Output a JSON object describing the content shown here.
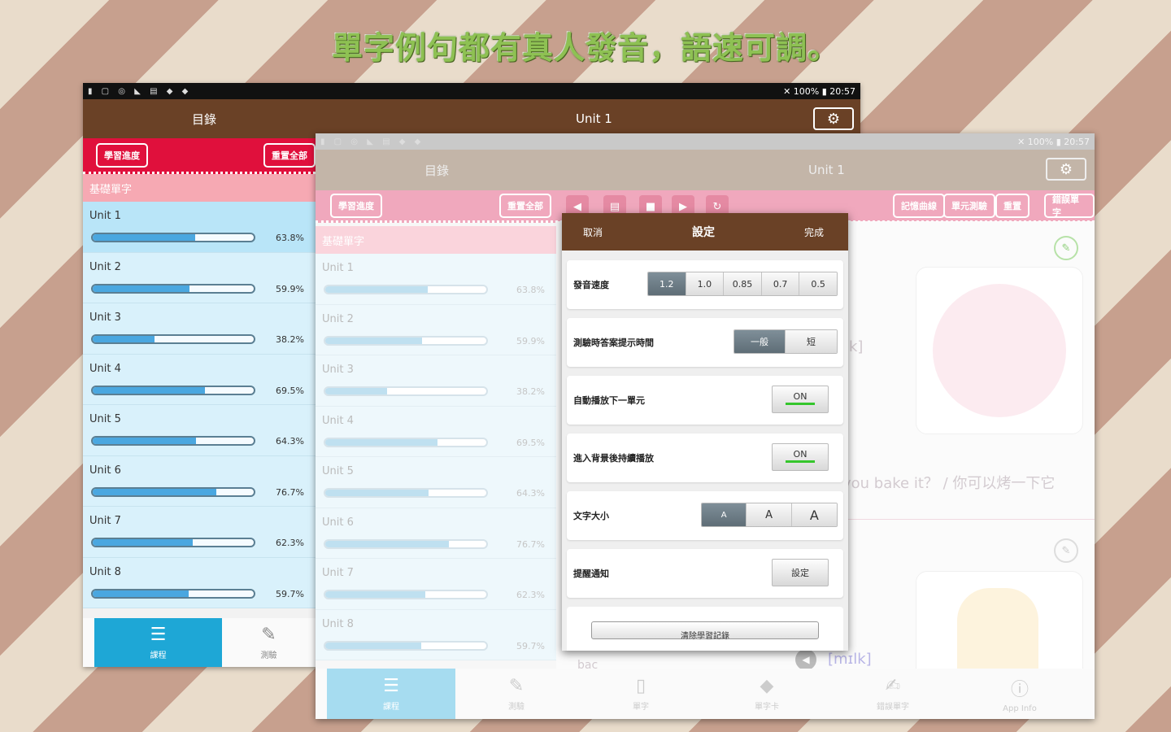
{
  "headline": "單字例句都有真人發音，語速可調。",
  "status": {
    "battery": "100%",
    "time": "20:57"
  },
  "back": {
    "nav_title": "目錄",
    "unit_title": "Unit 1",
    "ribbon_left": "學習進度",
    "ribbon_right": "重置全部",
    "section": "基礎單字",
    "units": [
      {
        "name": "Unit 1",
        "percent": "63.8%",
        "progress": 0.638
      },
      {
        "name": "Unit 2",
        "percent": "59.9%",
        "progress": 0.599
      },
      {
        "name": "Unit 3",
        "percent": "38.2%",
        "progress": 0.382
      },
      {
        "name": "Unit 4",
        "percent": "69.5%",
        "progress": 0.695
      },
      {
        "name": "Unit 5",
        "percent": "64.3%",
        "progress": 0.643
      },
      {
        "name": "Unit 6",
        "percent": "76.7%",
        "progress": 0.767
      },
      {
        "name": "Unit 7",
        "percent": "62.3%",
        "progress": 0.623
      },
      {
        "name": "Unit 8",
        "percent": "59.7%",
        "progress": 0.597
      }
    ],
    "bottom_nav": [
      {
        "label": "課程",
        "icon": "list-icon"
      },
      {
        "label": "測驗",
        "icon": "quiz-icon"
      }
    ]
  },
  "front": {
    "nav_title": "目錄",
    "unit_title": "Unit 1",
    "ribbon_left": "學習進度",
    "ribbon_left2": "重置全部",
    "ribbon_right": [
      "記憶曲線",
      "單元測驗",
      "重置",
      "錯誤單字"
    ],
    "section": "基礎單字",
    "sentence": "you bake it？ / 你可以烤一下它",
    "phonetic_partial": "k]",
    "phonetic2": "[mɪlk]",
    "word_partial": "bac",
    "bottom_nav": [
      "課程",
      "測驗",
      "單字",
      "單字卡",
      "錯誤單字",
      "App Info"
    ]
  },
  "dialog": {
    "cancel": "取消",
    "title": "設定",
    "done": "完成",
    "speed_label": "發音速度",
    "speeds": [
      "1.2",
      "1.0",
      "0.85",
      "0.7",
      "0.5"
    ],
    "speed_selected": "1.2",
    "quiz_label": "測驗時答案提示時間",
    "quiz_options": [
      "一般",
      "短"
    ],
    "quiz_selected": "一般",
    "autoplay_label": "自動播放下一單元",
    "autoplay_value": "ON",
    "bg_label": "進入背景後持續播放",
    "bg_value": "ON",
    "font_label": "文字大小",
    "font_options": [
      "A",
      "A",
      "A"
    ],
    "reminder_label": "提醒通知",
    "reminder_button": "設定",
    "reset_button": "清除學習記錄"
  },
  "colors": {
    "brown": "#6a4126",
    "red": "#e0103c",
    "blue": "#4aa7e0",
    "green_on": "#35c62c"
  }
}
